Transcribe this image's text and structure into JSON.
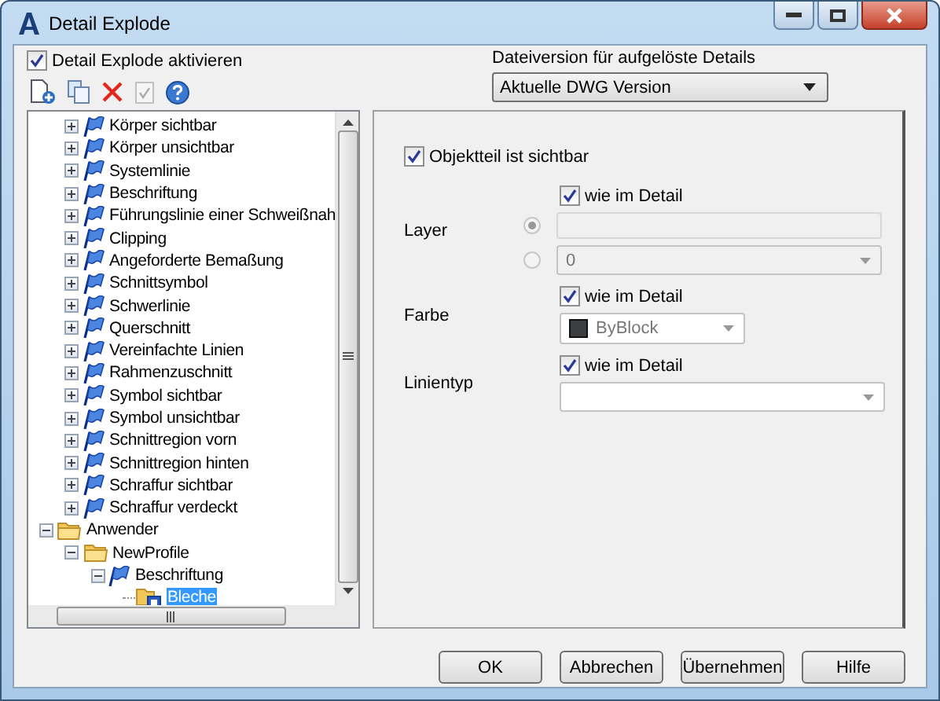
{
  "window": {
    "title": "Detail Explode"
  },
  "enable_checkbox": {
    "label": "Detail Explode aktivieren",
    "checked": true
  },
  "toolbar": [
    {
      "kind": "new",
      "disabled": false
    },
    {
      "kind": "copy",
      "disabled": false
    },
    {
      "kind": "delete",
      "disabled": false
    },
    {
      "kind": "check",
      "disabled": true
    },
    {
      "kind": "help",
      "disabled": false
    }
  ],
  "file_version": {
    "label": "Dateiversion für aufgelöste Details",
    "value": "Aktuelle DWG Version"
  },
  "tree": {
    "items": [
      {
        "label": "Körper sichtbar",
        "kind": "flag",
        "expanded": false,
        "selected": false
      },
      {
        "label": "Körper unsichtbar",
        "kind": "flag",
        "expanded": false,
        "selected": false
      },
      {
        "label": "Systemlinie",
        "kind": "flag",
        "expanded": false,
        "selected": false
      },
      {
        "label": "Beschriftung",
        "kind": "flag",
        "expanded": false,
        "selected": false
      },
      {
        "label": "Führungslinie einer Schweißnah",
        "kind": "flag",
        "expanded": false,
        "selected": false
      },
      {
        "label": "Clipping",
        "kind": "flag",
        "expanded": false,
        "selected": false
      },
      {
        "label": "Angeforderte Bemaßung",
        "kind": "flag",
        "expanded": false,
        "selected": false
      },
      {
        "label": "Schnittsymbol",
        "kind": "flag",
        "expanded": false,
        "selected": false
      },
      {
        "label": "Schwerlinie",
        "kind": "flag",
        "expanded": false,
        "selected": false
      },
      {
        "label": "Querschnitt",
        "kind": "flag",
        "expanded": false,
        "selected": false
      },
      {
        "label": "Vereinfachte Linien",
        "kind": "flag",
        "expanded": false,
        "selected": false
      },
      {
        "label": "Rahmenzuschnitt",
        "kind": "flag",
        "expanded": false,
        "selected": false
      },
      {
        "label": "Symbol sichtbar",
        "kind": "flag",
        "expanded": false,
        "selected": false
      },
      {
        "label": "Symbol unsichtbar",
        "kind": "flag",
        "expanded": false,
        "selected": false
      },
      {
        "label": "Schnittregion vorn",
        "kind": "flag",
        "expanded": false,
        "selected": false
      },
      {
        "label": "Schnittregion hinten",
        "kind": "flag",
        "expanded": false,
        "selected": false
      },
      {
        "label": "Schraffur sichtbar",
        "kind": "flag",
        "expanded": false,
        "selected": false
      },
      {
        "label": "Schraffur verdeckt",
        "kind": "flag",
        "expanded": false,
        "selected": false
      },
      {
        "label": "Anwender",
        "kind": "folder",
        "expanded": true,
        "selected": false,
        "children": [
          {
            "label": "NewProfile",
            "kind": "folder",
            "expanded": true,
            "selected": false,
            "children": [
              {
                "label": "Beschriftung",
                "kind": "flag",
                "expanded": true,
                "selected": false,
                "children": [
                  {
                    "label": "Bleche",
                    "kind": "detail",
                    "selected": true
                  }
                ]
              }
            ]
          }
        ]
      }
    ]
  },
  "properties": {
    "visible_checkbox": {
      "label": "Objektteil ist sichtbar",
      "checked": true
    },
    "layer": {
      "label": "Layer",
      "same_as_detail": {
        "label": "wie im Detail",
        "checked": true
      },
      "options": [
        {
          "kind": "text",
          "selected": true
        },
        {
          "kind": "dropdown",
          "selected": false,
          "value": "0"
        }
      ]
    },
    "color": {
      "label": "Farbe",
      "same_as_detail": {
        "label": "wie im Detail",
        "checked": true
      },
      "value": "ByBlock",
      "color": "#3c3f42"
    },
    "linetype": {
      "label": "Linientyp",
      "same_as_detail": {
        "label": "wie im Detail",
        "checked": true
      }
    }
  },
  "buttons": [
    "OK",
    "Abbrechen",
    "Übernehmen",
    "Hilfe"
  ]
}
